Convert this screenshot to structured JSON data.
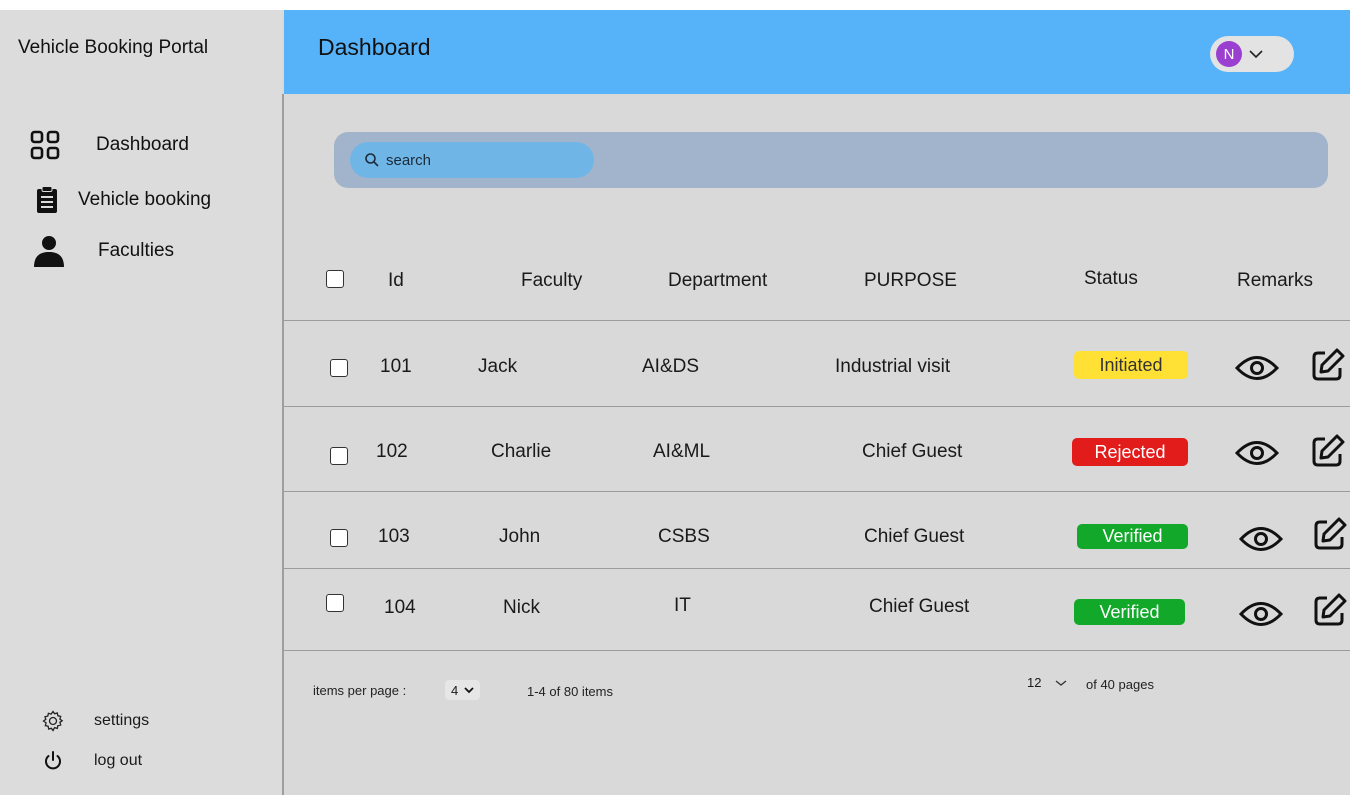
{
  "app": {
    "title": "Vehicle Booking Portal"
  },
  "sidebar": {
    "items": [
      {
        "label": "Dashboard",
        "icon": "grid-icon"
      },
      {
        "label": "Vehicle booking",
        "icon": "clipboard-icon"
      },
      {
        "label": "Faculties",
        "icon": "user-icon"
      }
    ],
    "bottom": [
      {
        "label": "settings",
        "icon": "gear-icon"
      },
      {
        "label": "log out",
        "icon": "power-icon"
      }
    ]
  },
  "header": {
    "title": "Dashboard",
    "avatar_initial": "N",
    "color": "#56b3fa"
  },
  "search": {
    "placeholder": "search"
  },
  "table": {
    "columns": [
      "Id",
      "Faculty",
      "Department",
      "PURPOSE",
      "Status",
      "Remarks"
    ],
    "rows": [
      {
        "id": "101",
        "faculty": "Jack",
        "department": "AI&DS",
        "purpose": "Industrial visit",
        "status": "Initiated"
      },
      {
        "id": "102",
        "faculty": "Charlie",
        "department": "AI&ML",
        "purpose": "Chief Guest",
        "status": "Rejected"
      },
      {
        "id": "103",
        "faculty": "John",
        "department": "CSBS",
        "purpose": "Chief Guest",
        "status": "Verified"
      },
      {
        "id": "104",
        "faculty": "Nick",
        "department": "IT",
        "purpose": "Chief Guest",
        "status": "Verified"
      }
    ]
  },
  "status_colors": {
    "Initiated": "#ffe135",
    "Rejected": "#e21b1b",
    "Verified": "#12a82a"
  },
  "footer": {
    "items_per_page_label": "items per page :",
    "items_per_page_value": "4",
    "range_text": "1-4 of 80 items",
    "current_page": "12",
    "pages_text": "of 40 pages"
  }
}
